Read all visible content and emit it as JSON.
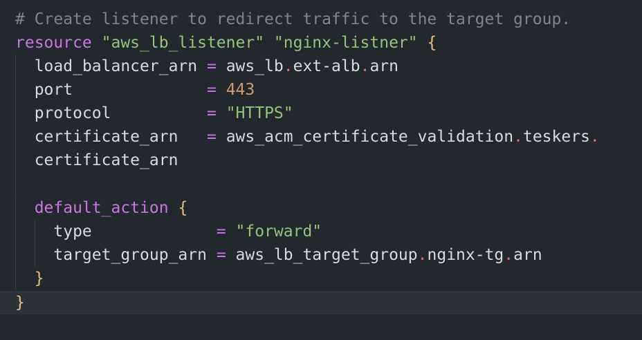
{
  "editor": {
    "colors": {
      "background": "#23272e",
      "active_line": "#2c313a",
      "comment": "#7f848e",
      "keyword": "#c678dd",
      "string": "#98c379",
      "number": "#d19a66",
      "brace": "#e5c07b",
      "dot": "#e06c75",
      "text": "#d7dae0"
    },
    "lines": [
      {
        "comment": "# Create listener to redirect traffic to the target group."
      },
      {
        "keyword": "resource",
        "s1": "\"aws_lb_listener\"",
        "s2": "\"nginx-listner\"",
        "brace": "{"
      },
      {
        "indent": "  ",
        "key": "load_balancer_arn",
        "pad": " ",
        "eq": "=",
        "v1": "aws_lb",
        "d1": ".",
        "v2": "ext-alb",
        "d2": ".",
        "v3": "arn"
      },
      {
        "indent": "  ",
        "key": "port",
        "pad": "              ",
        "eq": "=",
        "num": "443"
      },
      {
        "indent": "  ",
        "key": "protocol",
        "pad": "          ",
        "eq": "=",
        "str": "\"HTTPS\""
      },
      {
        "indent": "  ",
        "key": "certificate_arn",
        "pad": "   ",
        "eq": "=",
        "v1": "aws_acm_certificate_validation",
        "d1": ".",
        "v2": "teskers",
        "d2": "."
      },
      {
        "indent": "  ",
        "cont": "certificate_arn"
      },
      {
        "blank": ""
      },
      {
        "indent": "  ",
        "block": "default_action",
        "brace": "{"
      },
      {
        "indent": "    ",
        "key": "type",
        "pad": "             ",
        "eq": "=",
        "str": "\"forward\""
      },
      {
        "indent": "    ",
        "key": "target_group_arn",
        "pad": " ",
        "eq": "=",
        "v1": "aws_lb_target_group",
        "d1": ".",
        "v2": "nginx-tg",
        "d2": ".",
        "v3": "arn"
      },
      {
        "indent": "  ",
        "close": "}"
      },
      {
        "close": "}"
      }
    ]
  }
}
